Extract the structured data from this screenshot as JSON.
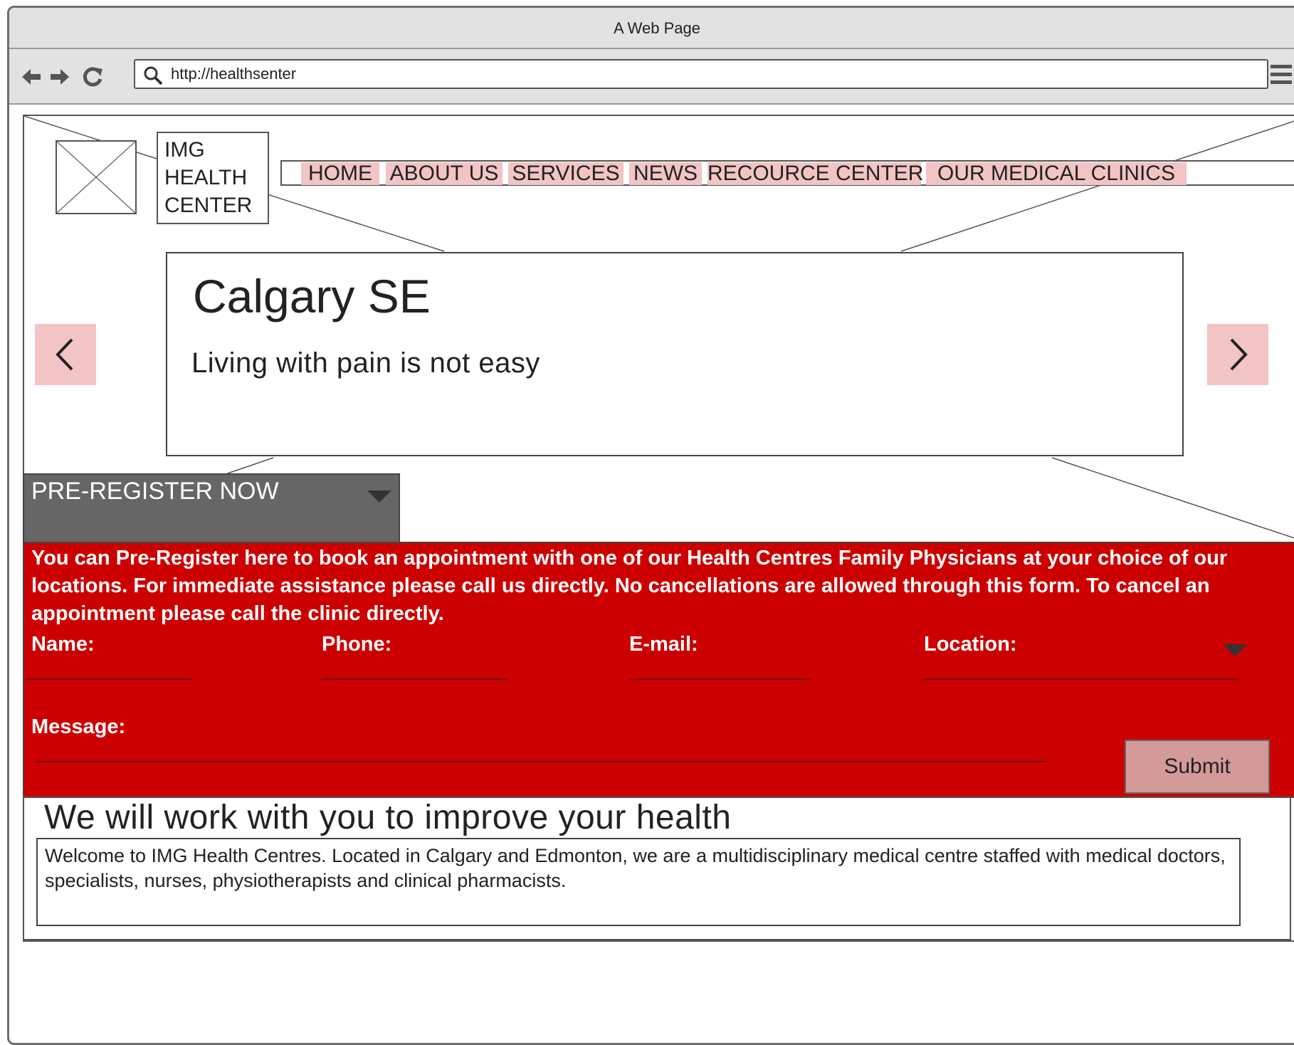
{
  "window": {
    "title": "A Web Page",
    "url": "http://healthsenter"
  },
  "logo": {
    "text": "IMG HEALTH CENTER"
  },
  "nav": {
    "items": [
      "HOME",
      "ABOUT US",
      "SERVICES",
      "NEWS",
      "RECOURCE CENTER",
      "OUR MEDICAL CLINICS"
    ]
  },
  "hero": {
    "title": "Calgary SE",
    "subtitle": "Living with pain is not easy"
  },
  "preregister": {
    "label": "PRE-REGISTER NOW"
  },
  "form": {
    "intro": "You can Pre-Register here to book an appointment with one of our Health Centres Family Physicians at your choice of our locations. For immediate assistance please call us directly. No cancellations are allowed through this form. To cancel an appointment please call the clinic directly.",
    "name_label": "Name:",
    "phone_label": "Phone:",
    "email_label": "E-mail:",
    "location_label": "Location:",
    "message_label": "Message:",
    "submit_label": "Submit"
  },
  "content": {
    "title": "We will work with you to improve your health",
    "body": "Welcome to IMG Health Centres. Located in Calgary and Edmonton, we are a multidisciplinary medical centre staffed with medical doctors, specialists, nurses, physiotherapists and clinical pharmacists."
  },
  "colors": {
    "accent_pink": "#f2c4c4",
    "form_red": "#cc0000",
    "dark_gray": "#666666"
  }
}
